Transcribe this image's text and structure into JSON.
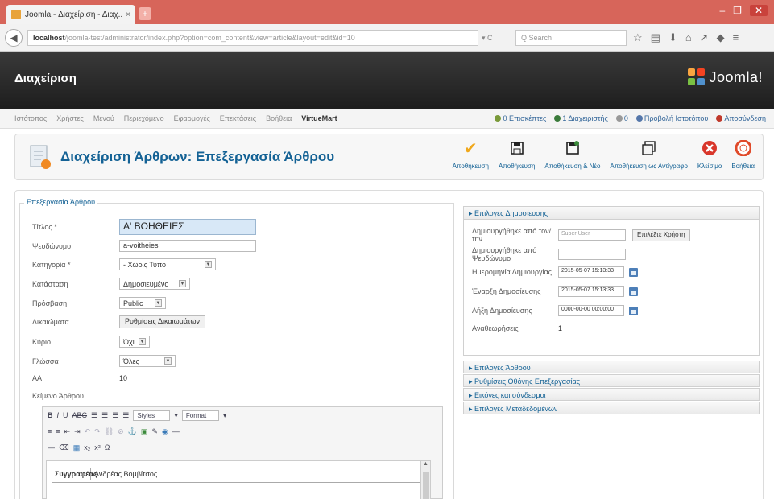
{
  "browser": {
    "tab_title": "Joomla - Διαχείριση - Διαχ...",
    "tab_close": "×",
    "new_tab": "+",
    "url_host": "localhost",
    "url_rest": "/joomla-test/administrator/index.php?option=com_content&view=article&layout=edit&id=10",
    "reload": "▾ C",
    "search_placeholder": "Q Search",
    "win_min": "–",
    "win_max": "❐",
    "win_close": "✕"
  },
  "joomla": {
    "admin_title": "Διαχείριση",
    "logo_text": "Joomla!",
    "main_menu": [
      "Ιστότοπος",
      "Χρήστες",
      "Μενού",
      "Περιεχόμενο",
      "Εφαρμογές",
      "Επεκτάσεις",
      "Βοήθεια",
      "VirtueMart"
    ],
    "status": {
      "visitors": "0 Επισκέπτες",
      "admins": "1 Διαχειριστής",
      "messages": "0",
      "view_site": "Προβολή Ιστοτόπου",
      "logout": "Αποσύνδεση"
    }
  },
  "toolbar": {
    "page_title": "Διαχείριση Άρθρων: Επεξεργασία Άρθρου",
    "buttons": [
      {
        "label": "Αποθήκευση"
      },
      {
        "label": "Αποθήκευση"
      },
      {
        "label": "Αποθήκευση & Νέο"
      },
      {
        "label": "Αποθήκευση ως Αντίγραφο"
      },
      {
        "label": "Κλείσιμο"
      },
      {
        "label": "Βοήθεια"
      }
    ]
  },
  "form": {
    "legend": "Επεξεργασία Άρθρου",
    "fields": {
      "title_label": "Τίτλος *",
      "title_value": "Α' ΒΟΗΘΕΙΕΣ",
      "alias_label": "Ψευδώνυμο",
      "alias_value": "a-voitheies",
      "category_label": "Κατηγορία *",
      "category_value": "- Χωρίς Τύπο",
      "status_label": "Κατάσταση",
      "status_value": "Δημοσιευμένο",
      "access_label": "Πρόσβαση",
      "access_value": "Public",
      "permissions_label": "Δικαιώματα",
      "permissions_button": "Ρυθμίσεις Δικαιωμάτων",
      "featured_label": "Κύριο",
      "featured_value": "Όχι",
      "language_label": "Γλώσσα",
      "language_value": "Όλες",
      "id_label": "ΑΑ",
      "id_value": "10",
      "text_label": "Κείμενο Άρθρου"
    },
    "editor": {
      "row1": [
        "B",
        "I",
        "U",
        "ABC"
      ],
      "styles_placeholder": "Styles",
      "format_placeholder": "Format",
      "content_cell1": "Συγγραφέας",
      "content_cell2": "Ανδρέας Βομβίτσος",
      "scroll_up": "▲"
    }
  },
  "right_panel": {
    "publish_header": "Επιλογές Δημοσίευσης",
    "created_by_label": "Δημιουργήθηκε από τον/την",
    "created_by_value": "Super User",
    "select_user_button": "Επιλέξτε Χρήστη",
    "created_alias_label": "Δημιουργήθηκε από Ψευδώνυμο",
    "created_date_label": "Ημερομηνία Δημιουργίας",
    "created_date_value": "2015-05-07 15:13:33",
    "start_publish_label": "Έναρξη Δημοσίευσης",
    "start_publish_value": "2015-05-07 15:13:33",
    "finish_publish_label": "Λήξη Δημοσίευσης",
    "finish_publish_value": "0000-00-00 00:00:00",
    "revision_label": "Αναθεωρήσεις",
    "revision_value": "1",
    "accordions": [
      "Επιλογές Άρθρου",
      "Ρυθμίσεις Οθόνης Επεξεργασίας",
      "Εικόνες και σύνδεσμοι",
      "Επιλογές Μεταδεδομένων"
    ]
  },
  "colors": {
    "tab_bar": "#d7655a",
    "header_dark": "#1d1d1d",
    "link_blue": "#146295",
    "title_highlight": "#d8e8f7"
  }
}
